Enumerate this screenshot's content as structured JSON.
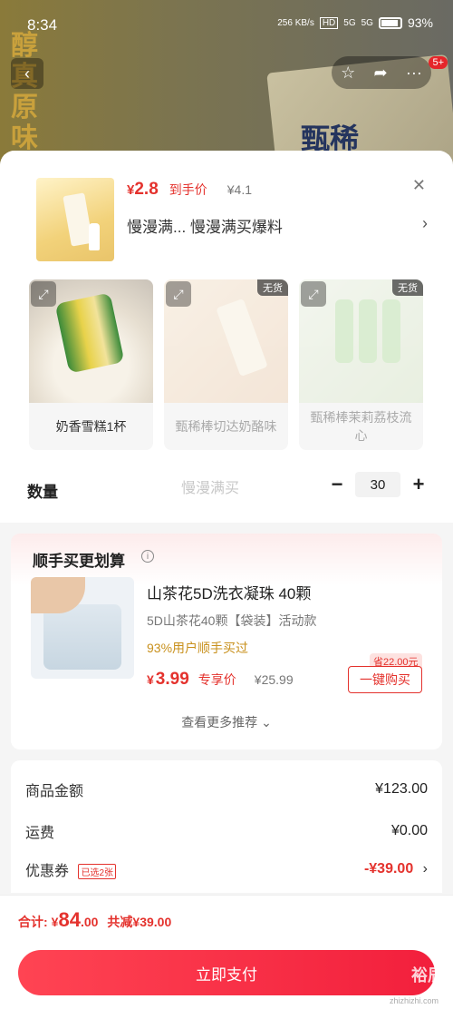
{
  "status_bar": {
    "time": "8:34",
    "network_speed": "256 KB/s",
    "hd": "HD",
    "sig1": "5G",
    "sig2": "5G",
    "battery": "93%"
  },
  "background_page": {
    "title_vertical": "醇真原味",
    "brand": "甄稀",
    "cart_badge": "5+"
  },
  "sheet": {
    "product": {
      "currency": "¥",
      "price": "2.8",
      "price_tag": "到手价",
      "original_price": "¥4.1",
      "promo_text": "慢漫满...  慢漫满买爆料"
    },
    "variants": [
      {
        "label": "奶香雪糕1杯",
        "sold_out": ""
      },
      {
        "label": "甄稀棒切达奶酪味",
        "sold_out": "无货"
      },
      {
        "label": "甄稀棒茉莉荔枝流心",
        "sold_out": "无货"
      }
    ],
    "ghost_text": "慢漫满买",
    "quantity": {
      "label": "数量",
      "minus": "−",
      "value": "30",
      "plus": "+"
    }
  },
  "recommendation": {
    "title": "顺手买更划算",
    "info": "i",
    "item": {
      "name": "山茶花5D洗衣凝珠 40颗",
      "spec": "5D山茶花40颗【袋装】活动款",
      "stat": "93%用户顺手买过",
      "currency": "¥",
      "price": "3.99",
      "price_tag": "专享价",
      "original_price": "¥25.99",
      "save_tag": "省22.00元",
      "buy_label": "一键购买"
    },
    "more_label": "查看更多推荐 ⌄"
  },
  "summary": {
    "rows": [
      {
        "label": "商品金额",
        "value": "¥123.00"
      },
      {
        "label": "运费",
        "value": "¥0.00"
      },
      {
        "label": "优惠券",
        "tag": "已选2张",
        "value": "-¥39.00"
      }
    ]
  },
  "footer": {
    "total_label": "合计:",
    "total_currency": "¥",
    "total_big": "84",
    "total_small": ".00",
    "saved": "共减¥39.00",
    "pay_label": "立即支付",
    "watermark": "裕辰",
    "watermark_small": "zhizhizhi.com"
  }
}
